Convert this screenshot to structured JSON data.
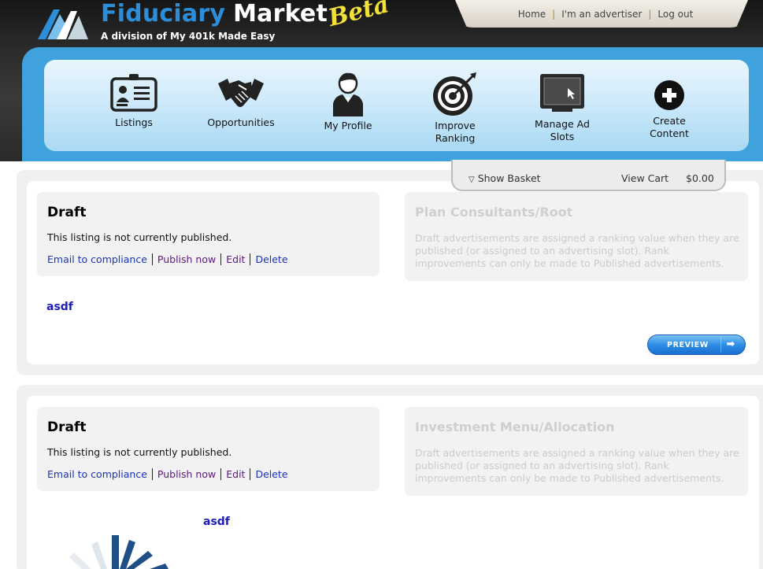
{
  "brand": {
    "title_part1": "Fiduciary",
    "title_part2": "Market",
    "subtitle": "A division of My 401k Made Easy",
    "badge": "Beta"
  },
  "toplinks": [
    "Home",
    "I'm an advertiser",
    "Log out"
  ],
  "nav": [
    {
      "label": "Listings",
      "icon": "listings-icon"
    },
    {
      "label": "Opportunities",
      "icon": "handshake-icon"
    },
    {
      "label": "My Profile",
      "icon": "profile-icon"
    },
    {
      "label": "Improve\nRanking",
      "icon": "target-icon"
    },
    {
      "label": "Manage Ad\nSlots",
      "icon": "monitor-icon"
    },
    {
      "label": "Create\nContent",
      "icon": "plus-circle-icon"
    }
  ],
  "basket": {
    "show_label": "Show Basket",
    "cart_label": "View Cart",
    "total": "$0.00"
  },
  "listings": [
    {
      "status_title": "Draft",
      "status_message": "This listing is not currently published.",
      "actions": [
        "Email to compliance",
        "Publish now",
        "Edit",
        "Delete"
      ],
      "category": "Plan Consultants/Root",
      "ranking_note": "Draft advertisements are assigned a ranking value when they are published (or assigned to an advertising slot). Rank improvements can only be made to Published advertisements.",
      "name": "asdf",
      "preview_label": "PREVIEW"
    },
    {
      "status_title": "Draft",
      "status_message": "This listing is not currently published.",
      "actions": [
        "Email to compliance",
        "Publish now",
        "Edit",
        "Delete"
      ],
      "category": "Investment Menu/Allocation",
      "ranking_note": "Draft advertisements are assigned a ranking value when they are published (or assigned to an advertising slot). Rank improvements can only be made to Published advertisements.",
      "name": "asdf"
    }
  ],
  "colors": {
    "brand_blue": "#2c8ed8",
    "nav_blue": "#3fa2dd",
    "link_blue": "#1b34b9",
    "visited_purple": "#5a1a7a",
    "beta_yellow": "#f2e13a"
  }
}
